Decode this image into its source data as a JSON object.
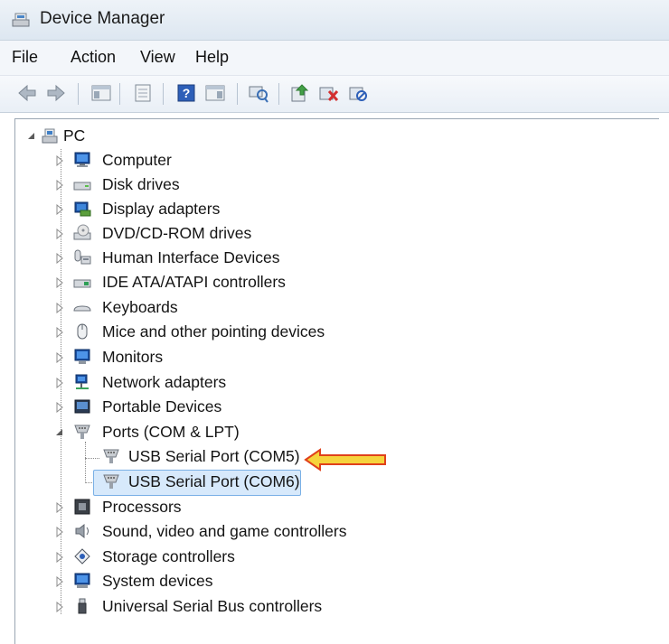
{
  "window": {
    "title": "Device Manager"
  },
  "menu": {
    "items": [
      "File",
      "Action",
      "View",
      "Help"
    ]
  },
  "toolbar": {
    "buttons": [
      "back-icon",
      "forward-icon",
      "show-hide-console-tree-icon",
      "properties-sheet-icon",
      "help-icon",
      "action-pane-icon",
      "scan-hardware-icon",
      "update-driver-icon",
      "uninstall-device-icon",
      "disable-device-icon"
    ]
  },
  "tree": {
    "root": "PC",
    "categories": [
      {
        "label": "Computer",
        "icon": "computer-icon"
      },
      {
        "label": "Disk drives",
        "icon": "disk-drive-icon"
      },
      {
        "label": "Display adapters",
        "icon": "display-adapter-icon"
      },
      {
        "label": "DVD/CD-ROM drives",
        "icon": "dvd-drive-icon"
      },
      {
        "label": "Human Interface Devices",
        "icon": "hid-icon"
      },
      {
        "label": "IDE ATA/ATAPI controllers",
        "icon": "ide-controller-icon"
      },
      {
        "label": "Keyboards",
        "icon": "keyboard-icon"
      },
      {
        "label": "Mice and other pointing devices",
        "icon": "mouse-icon"
      },
      {
        "label": "Monitors",
        "icon": "monitor-icon"
      },
      {
        "label": "Network adapters",
        "icon": "network-adapter-icon"
      },
      {
        "label": "Portable Devices",
        "icon": "portable-device-icon"
      },
      {
        "label": "Ports (COM & LPT)",
        "icon": "port-icon",
        "expanded": true,
        "children": [
          {
            "label": "USB Serial Port (COM5)",
            "icon": "port-icon"
          },
          {
            "label": "USB Serial Port (COM6)",
            "icon": "port-icon",
            "selected": true
          }
        ]
      },
      {
        "label": "Processors",
        "icon": "processor-icon"
      },
      {
        "label": "Sound, video and game controllers",
        "icon": "speaker-icon"
      },
      {
        "label": "Storage controllers",
        "icon": "storage-controller-icon"
      },
      {
        "label": "System devices",
        "icon": "system-device-icon"
      },
      {
        "label": "Universal Serial Bus controllers",
        "icon": "usb-icon"
      }
    ]
  },
  "annotation": {
    "arrow_color": "#f5d23a",
    "arrow_outline": "#e0401a"
  }
}
